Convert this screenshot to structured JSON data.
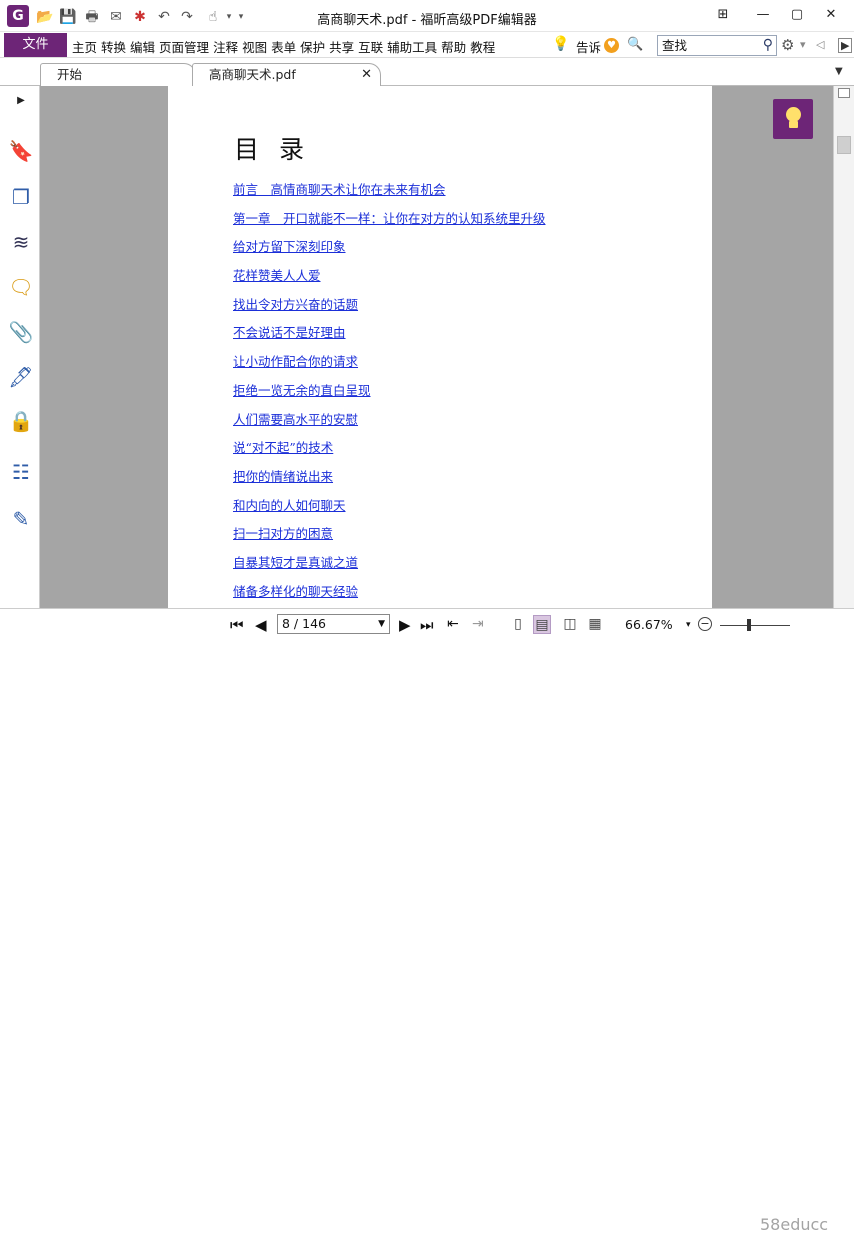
{
  "window": {
    "title": "高商聊天术.pdf - 福昕高级PDF编辑器",
    "controls": [
      "⊞",
      "—",
      "▢",
      "✕"
    ]
  },
  "app_icon": "G",
  "ribbon": {
    "file_label": "文件",
    "menus": [
      "主页",
      "转换",
      "编辑",
      "页面管理",
      "注释",
      "视图",
      "表单",
      "保护",
      "共享",
      "互联",
      "辅助工具",
      "帮助",
      "教程"
    ],
    "tell_me": "告诉",
    "search_placeholder": "查找"
  },
  "tabs": [
    {
      "label": "开始"
    },
    {
      "label": "高商聊天术.pdf",
      "close": "✕"
    }
  ],
  "document": {
    "heading": "目 录",
    "toc": [
      "前言　高情商聊天术让你在未来有机会",
      "第一章　开口就能不一样：让你在对方的认知系统里升级",
      "给对方留下深刻印象",
      "花样赞美人人爱",
      "找出令对方兴奋的话题",
      "不会说话不是好理由",
      "让小动作配合你的请求",
      "拒绝一览无余的直白呈现",
      "人们需要高水平的安慰",
      "说“对不起”的技术",
      "把你的情绪说出来",
      "和内向的人如何聊天",
      "扫一扫对方的困意",
      "自暴其短才是真诚之道",
      "储备多样化的聊天经验"
    ]
  },
  "status": {
    "page_indicator": "8 / 146",
    "zoom": "66.67%",
    "watermark": "58educc"
  },
  "colors": {
    "accent": "#6d2577",
    "link": "#1b2fd8",
    "gutter": "#a5a5a5"
  }
}
